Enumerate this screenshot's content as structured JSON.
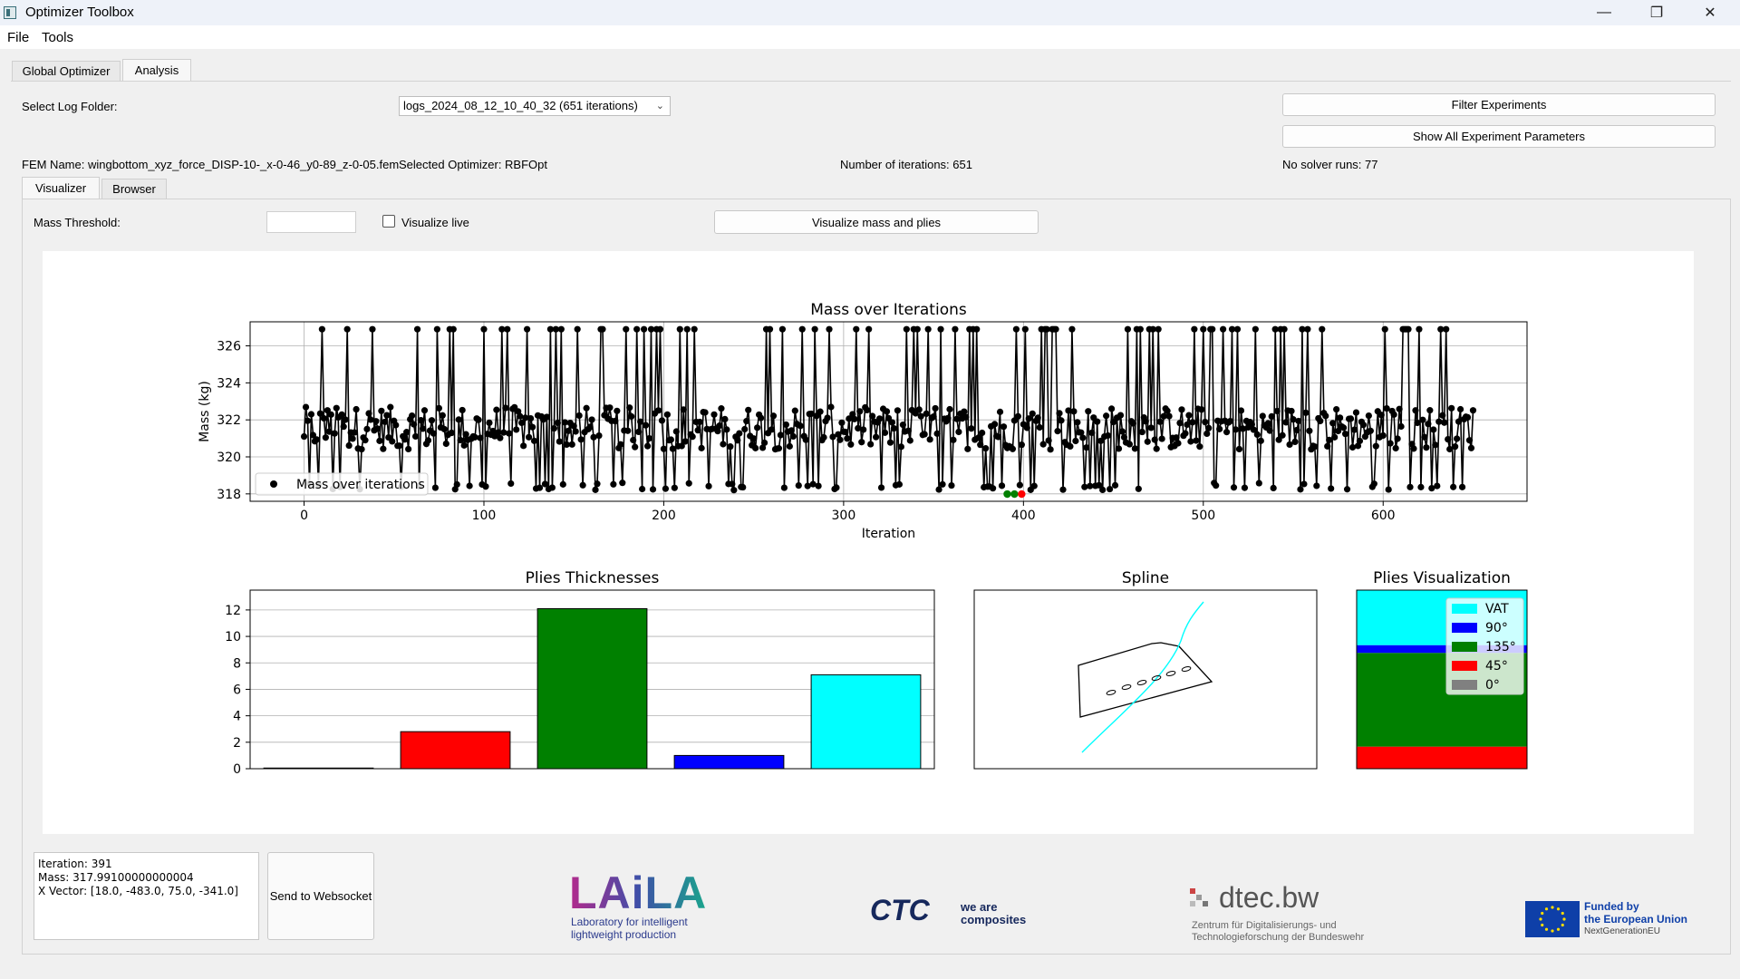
{
  "window": {
    "title": "Optimizer Toolbox"
  },
  "menu": [
    "File",
    "Tools"
  ],
  "tabs": [
    "Global Optimizer",
    "Analysis"
  ],
  "subtabs": [
    "Visualizer",
    "Browser"
  ],
  "log_folder": {
    "label": "Select Log Folder:",
    "value": "logs_2024_08_12_10_40_32 (651 iterations)"
  },
  "buttons": {
    "filter": "Filter Experiments",
    "show_all": "Show All Experiment Parameters",
    "visualize": "Visualize mass and plies",
    "send": "Send to Websocket"
  },
  "info": {
    "fem_name": "FEM Name: wingbottom_xyz_force_DISP-10-_x-0-46_y0-89_z-0-05.fem",
    "optimizer": "Selected Optimizer: RBFOpt",
    "iterations": "Number of iterations: 651",
    "solver_runs": "No solver runs: 77"
  },
  "mass_threshold": {
    "label": "Mass Threshold:",
    "value": ""
  },
  "visualize_live": {
    "label": "Visualize live",
    "checked": false
  },
  "selection": {
    "iteration": "Iteration: 391",
    "mass": "Mass: 317.99100000000004",
    "x_vector": "X Vector: [18.0, -483.0, 75.0, -341.0]"
  },
  "logos": {
    "laila_word": "LAiLA",
    "laila_sub1": "Laboratory for intelligent",
    "laila_sub2": "lightweight production",
    "ctc_word": "CTC",
    "ctc_sub1": "we are",
    "ctc_sub2": "composites",
    "dtec_word": "dtec.bw",
    "dtec_sub1": "Zentrum für Digitalisierungs- und",
    "dtec_sub2": "Technologieforschung der Bundeswehr",
    "eu_1": "Funded by",
    "eu_2": "the European Union",
    "eu_3": "NextGenerationEU"
  },
  "colors": {
    "vat": "#00ffff",
    "deg90": "#0000ff",
    "deg135": "#008000",
    "deg45": "#ff0000",
    "deg0": "#808080"
  },
  "chart_data": [
    {
      "type": "line",
      "title": "Mass over Iterations",
      "xlabel": "Iteration",
      "ylabel": "Mass (kg)",
      "xlim": [
        -30,
        680
      ],
      "ylim": [
        317.6,
        327.3
      ],
      "xticks": [
        0,
        100,
        200,
        300,
        400,
        500,
        600
      ],
      "yticks": [
        318,
        320,
        322,
        324,
        326
      ],
      "grid": true,
      "legend": "lower-left",
      "series": [
        {
          "name": "Mass over iterations",
          "points": "651 points oscillating between ~318.0 and ~326.9 kg"
        }
      ],
      "highlights": [
        {
          "x": 391,
          "y": 317.991,
          "color": "green"
        },
        {
          "x": 395,
          "y": 317.99,
          "color": "green"
        },
        {
          "x": 399,
          "y": 317.99,
          "color": "red"
        }
      ]
    },
    {
      "type": "bar",
      "title": "Plies Thicknesses",
      "categories": [
        "0°",
        "45°",
        "135°",
        "90°",
        "VAT"
      ],
      "values": [
        0.05,
        2.8,
        12.1,
        1.0,
        7.1
      ],
      "colors": [
        "#808080",
        "#ff0000",
        "#008000",
        "#0000ff",
        "#00ffff"
      ],
      "ylim": [
        0,
        13.5
      ],
      "yticks": [
        0,
        2,
        4,
        6,
        8,
        10,
        12
      ],
      "grid": true
    },
    {
      "type": "line",
      "title": "Spline",
      "series": [
        {
          "name": "spline",
          "color": "#00ffff"
        }
      ]
    },
    {
      "type": "bar",
      "title": "Plies Visualization",
      "stacked": true,
      "legend": "top-right",
      "layers": [
        {
          "name": "0°",
          "value": 0.05,
          "color": "#808080"
        },
        {
          "name": "45°",
          "value": 2.8,
          "color": "#ff0000"
        },
        {
          "name": "135°",
          "value": 12.1,
          "color": "#008000"
        },
        {
          "name": "90°",
          "value": 1.0,
          "color": "#0000ff"
        },
        {
          "name": "VAT",
          "value": 7.1,
          "color": "#00ffff"
        }
      ],
      "legend_entries": [
        "VAT",
        "90°",
        "135°",
        "45°",
        "0°"
      ]
    }
  ]
}
